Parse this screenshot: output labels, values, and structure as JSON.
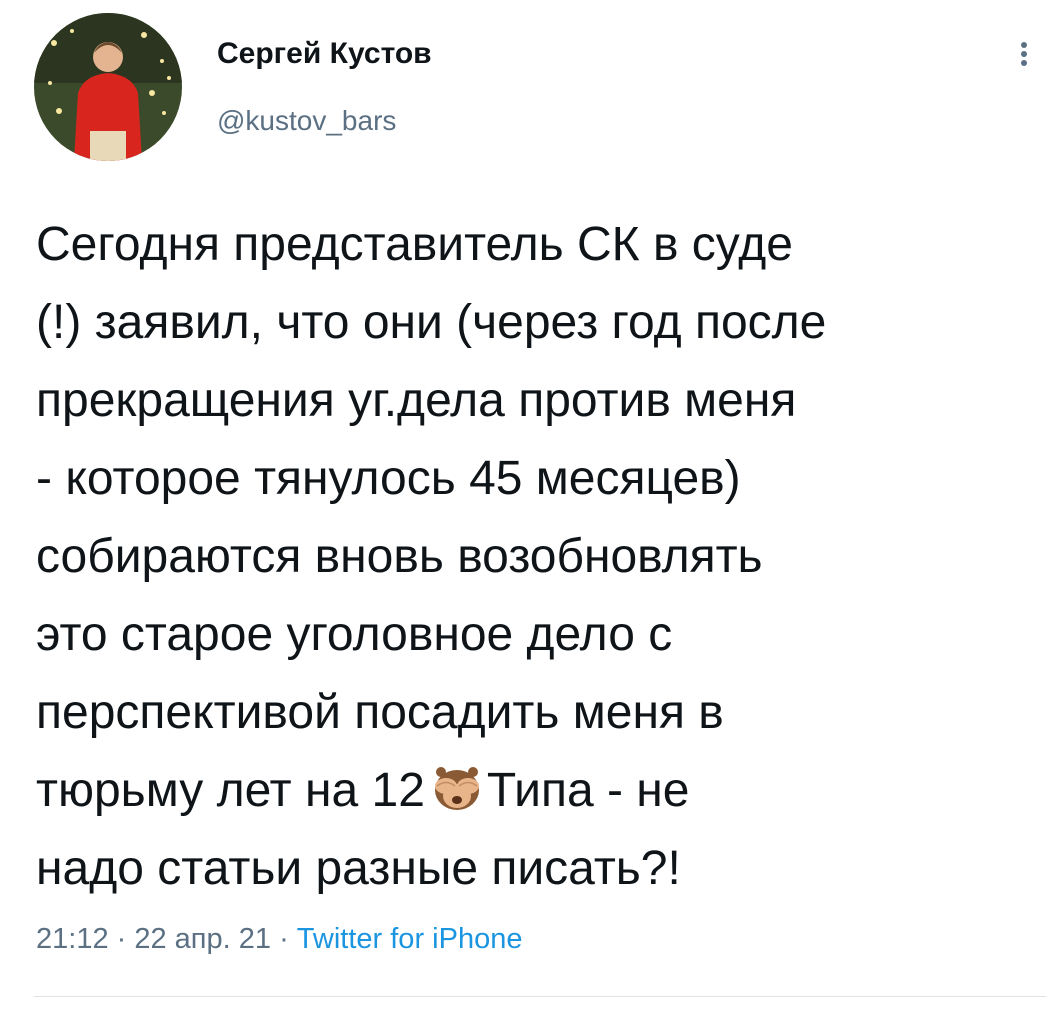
{
  "author": {
    "name": "Сергей Кустов",
    "handle": "@kustov_bars"
  },
  "tweet": {
    "lines": [
      "Сегодня представитель СК в суде",
      "(!) заявил, что они (через год после",
      "прекращения уг.дела против меня",
      "- которое тянулось 45 месяцев)",
      "собираются вновь возобновлять",
      "это старое уголовное дело с",
      "перспективой посадить меня в"
    ],
    "line8_before": "тюрьму лет на 12",
    "line8_emoji": "see-no-evil-monkey",
    "line8_after": "Типа -  не",
    "line9": "надо статьи разные писать?!"
  },
  "meta": {
    "time": "21:12",
    "sep1": " · ",
    "date": "22 апр. 21",
    "sep2": " · ",
    "source": "Twitter for iPhone"
  },
  "icons": {
    "more": "vertical-ellipsis-icon",
    "emoji": "see-no-evil-monkey-icon"
  },
  "colors": {
    "text": "#0f1419",
    "secondary": "#5b7083",
    "link": "#1b95e0",
    "divider": "#dfe3e6"
  }
}
